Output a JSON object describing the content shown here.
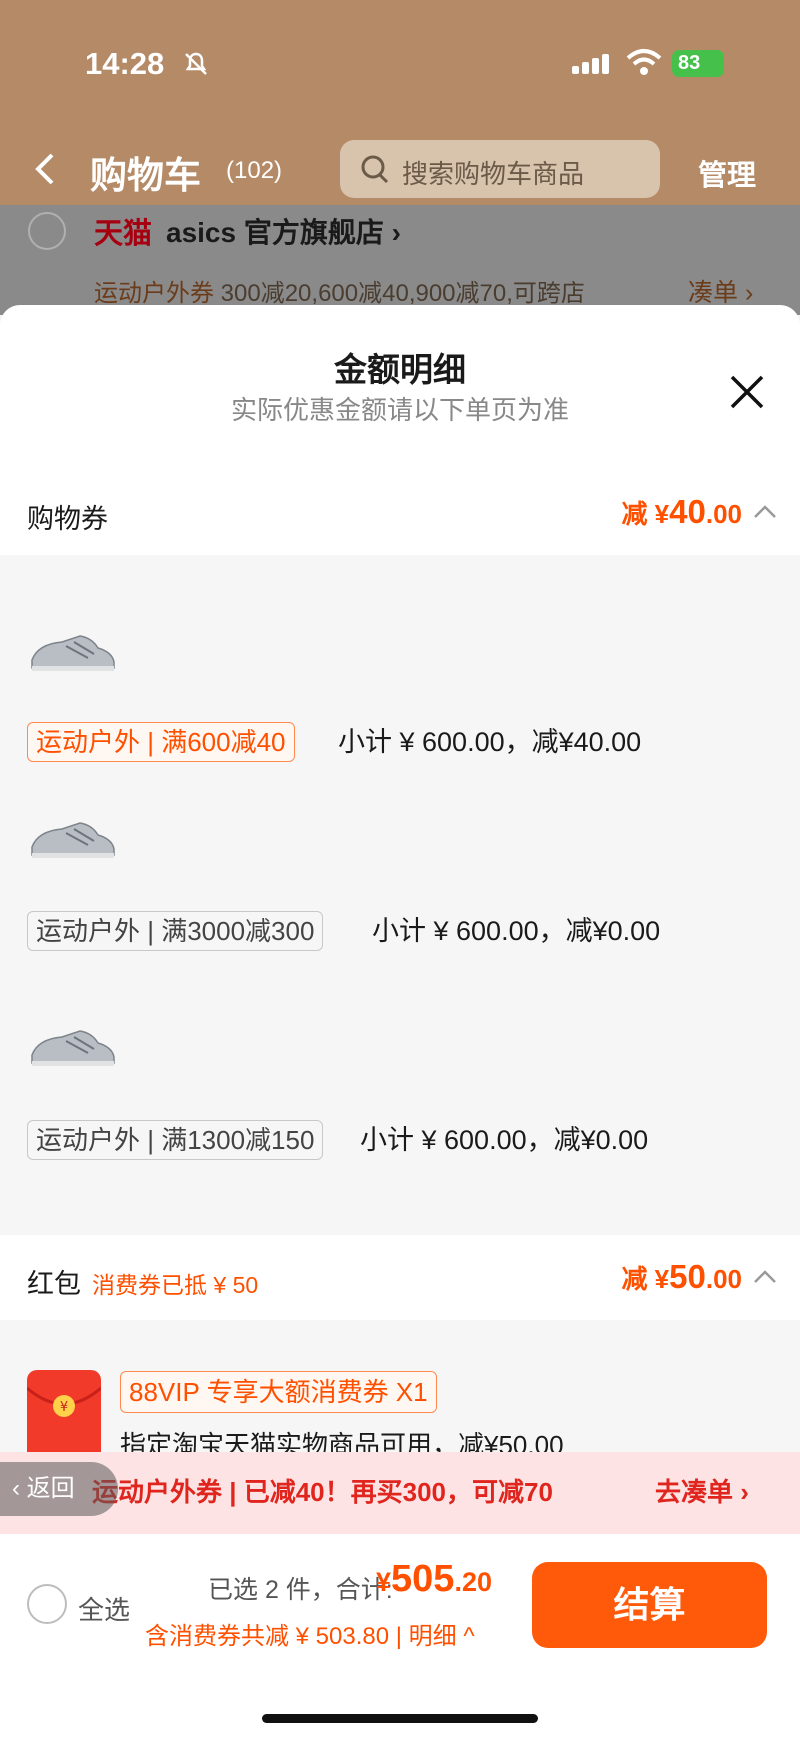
{
  "status_bar": {
    "time": "14:28",
    "battery": "83"
  },
  "header": {
    "title": "购物车",
    "count": "(102)",
    "search_placeholder": "搜索购物车商品",
    "manage": "管理"
  },
  "shop": {
    "brand": "天猫",
    "name": "asics 官方旗舰店 ›",
    "promo_tag": "运动户外券",
    "promo_text": "300减20,600减40,900减70,可跨店",
    "promo_action": "凑单 ›"
  },
  "sheet": {
    "title": "金额明细",
    "subtitle": "实际优惠金额请以下单页为准",
    "coupon_section": {
      "label": "购物券",
      "prefix": "减 ¥",
      "amount_int": "40",
      "amount_dec": ".00"
    },
    "items": [
      {
        "coupon": "运动户外 | 满600减40",
        "subtotal": "小计 ¥ 600.00，减¥40.00",
        "active": true
      },
      {
        "coupon": "运动户外 | 满3000减300",
        "subtotal": "小计 ¥ 600.00，减¥0.00",
        "active": false
      },
      {
        "coupon": "运动户外 | 满1300减150",
        "subtotal": "小计 ¥ 600.00，减¥0.00",
        "active": false
      }
    ],
    "redpacket_section": {
      "label": "红包",
      "note": "消费券已抵 ¥ 50",
      "prefix": "减 ¥",
      "amount_int": "50",
      "amount_dec": ".00"
    },
    "redpacket": {
      "tag": "88VIP 专享大额消费券 X1",
      "desc": "指定淘宝天猫实物商品可用，减¥50.00"
    }
  },
  "banner": {
    "text": "运动户外券 | 已减40！再买300，可减70",
    "cta": "去凑单 ›",
    "back": "返回"
  },
  "footer": {
    "select_all": "全选",
    "selected": "已选 2 件，合计:",
    "total_symbol": "¥",
    "total_int": "505",
    "total_dec": ".20",
    "savings": "含消费券共减 ¥ 503.80 | 明细 ^",
    "checkout": "结算"
  },
  "colors": {
    "accent": "#ff5000",
    "header_bg": "#b48a67",
    "banner_bg": "#fde3e3"
  }
}
